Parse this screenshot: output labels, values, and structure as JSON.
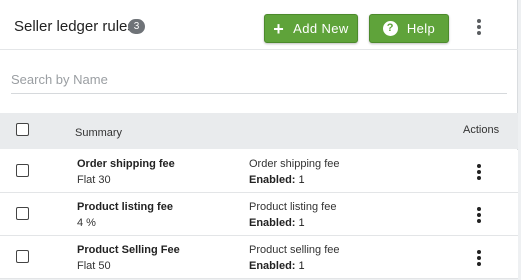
{
  "header": {
    "title": "Seller ledger rules",
    "count": "3",
    "add_label": "Add New",
    "help_label": "Help",
    "add_icon": "plus-icon",
    "help_icon": "question-icon",
    "more_icon": "vertical-dots-icon"
  },
  "search": {
    "placeholder": "Search by Name",
    "value": ""
  },
  "table": {
    "columns": {
      "summary": "Summary",
      "actions": "Actions"
    },
    "enabled_label": "Enabled:",
    "rows": [
      {
        "name": "Order shipping fee",
        "value": "Flat 30",
        "description": "Order shipping fee",
        "enabled": "1"
      },
      {
        "name": "Product listing fee",
        "value": "4 %",
        "description": "Product listing fee",
        "enabled": "1"
      },
      {
        "name": "Product Selling Fee",
        "value": "Flat 50",
        "description": "Product selling fee",
        "enabled": "1"
      }
    ]
  },
  "colors": {
    "button_green": "#5fa33a",
    "badge_gray": "#6f7378",
    "header_gray": "#e9ebed"
  }
}
